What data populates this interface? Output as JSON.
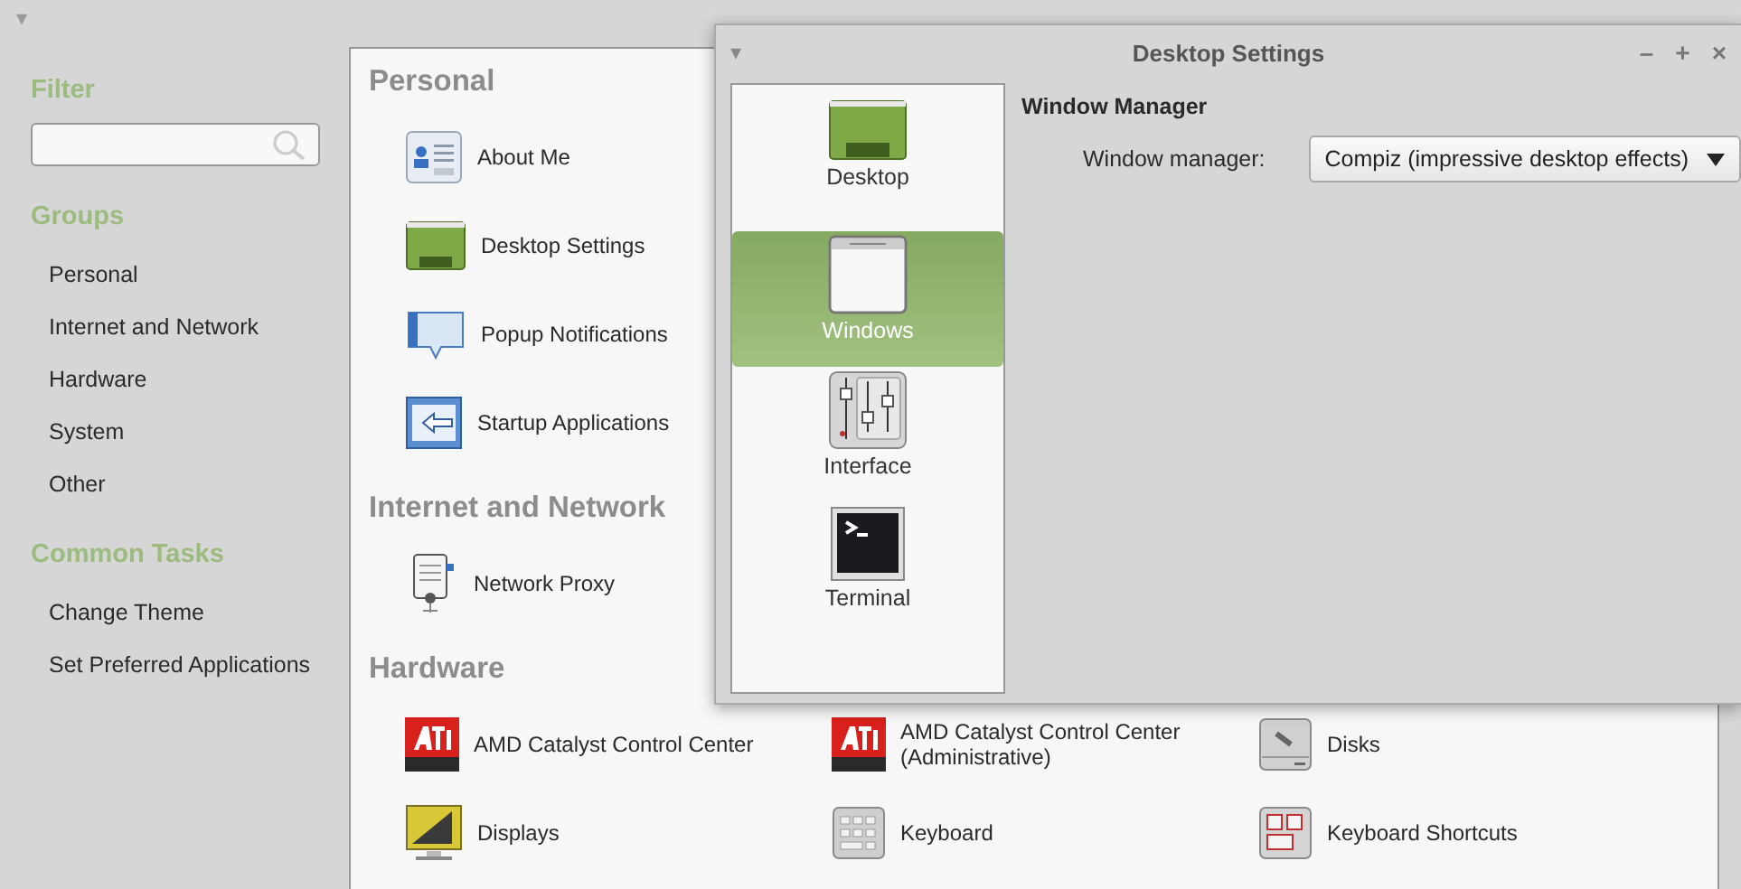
{
  "window": {
    "menu_glyph": "▾"
  },
  "sidebar": {
    "filter_heading": "Filter",
    "groups_heading": "Groups",
    "groups": [
      {
        "label": "Personal"
      },
      {
        "label": "Internet and Network"
      },
      {
        "label": "Hardware"
      },
      {
        "label": "System"
      },
      {
        "label": "Other"
      }
    ],
    "tasks_heading": "Common Tasks",
    "tasks": [
      {
        "label": "Change Theme"
      },
      {
        "label": "Set Preferred Applications"
      }
    ]
  },
  "sections": [
    {
      "title": "Personal",
      "rows": [
        [
          {
            "label": "About Me"
          }
        ],
        [
          {
            "label": "Desktop Settings"
          }
        ],
        [
          {
            "label": "Popup Notifications"
          }
        ],
        [
          {
            "label": "Startup Applications"
          }
        ]
      ]
    },
    {
      "title": "Internet and Network",
      "rows": [
        [
          {
            "label": "Network Proxy"
          }
        ]
      ]
    },
    {
      "title": "Hardware",
      "rows": [
        [
          {
            "label": "AMD Catalyst Control Center"
          },
          {
            "label": "AMD Catalyst Control Center (Administrative)"
          },
          {
            "label": "Disks"
          }
        ],
        [
          {
            "label": "Displays"
          },
          {
            "label": "Keyboard"
          },
          {
            "label": "Keyboard Shortcuts"
          }
        ]
      ]
    }
  ],
  "dialog": {
    "menu_glyph": "▾",
    "title": "Desktop Settings",
    "controls": [
      "–",
      "+",
      "×"
    ],
    "pages": [
      {
        "label": "Desktop",
        "selected": false
      },
      {
        "label": "Windows",
        "selected": true
      },
      {
        "label": "Interface",
        "selected": false
      },
      {
        "label": "Terminal",
        "selected": false
      }
    ],
    "heading": "Window Manager",
    "field_label": "Window manager:",
    "combo_value": "Compiz (impressive desktop effects)"
  }
}
